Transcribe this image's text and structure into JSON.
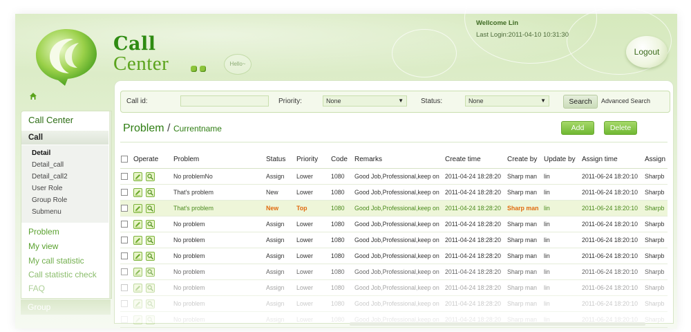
{
  "brand": {
    "line1": "Call",
    "line2": "Center",
    "hello": "Hello~"
  },
  "header": {
    "welcome": "Wellcome Lin",
    "last_login": "Last Login:2011-04-10 10:31:30",
    "logout": "Logout"
  },
  "colors": {
    "brand_green": "#2e8b12",
    "accent_green": "#6fb832",
    "highlight_orange": "#e06b10"
  },
  "sidebar": {
    "title": "Call Center",
    "section": "Call",
    "sub_items": [
      "Detail",
      "Detail_call",
      "Detail_call2",
      "User Role",
      "Group Role",
      "Submenu"
    ],
    "active_sub": "Detail",
    "links": [
      "Problem",
      "My view",
      "My call statistic",
      "Call statistic check",
      "FAQ"
    ],
    "group": "Group"
  },
  "search": {
    "callid_label": "Call id:",
    "callid_value": "",
    "priority_label": "Priority:",
    "priority_value": "None",
    "status_label": "Status:",
    "status_value": "None",
    "search_button": "Search",
    "advanced": "Advanced Search"
  },
  "page": {
    "title": "Problem",
    "slash": "/",
    "subtitle": "Currentname",
    "add": "Add",
    "delete": "Delete"
  },
  "table": {
    "columns": [
      "Operate",
      "Problem",
      "Status",
      "Priority",
      "Code",
      "Remarks",
      "Create time",
      "Create by",
      "Update by",
      "Assign time",
      "Assign"
    ],
    "rows": [
      {
        "problem": "No problemNo",
        "status": "Assign",
        "priority": "Lower",
        "code": "1080",
        "remarks": "Good Job,Professional,keep on",
        "create_time": "2011-04-24 18:28:20",
        "create_by": "Sharp man",
        "update_by": "lin",
        "assign_time": "2011-06-24 18:20:10",
        "assign": "Sharpb"
      },
      {
        "problem": "That's problem",
        "status": "New",
        "priority": "Lower",
        "code": "1080",
        "remarks": "Good Job,Professional,keep on",
        "create_time": "2011-04-24 18:28:20",
        "create_by": "Sharp man",
        "update_by": "lin",
        "assign_time": "2011-06-24 18:20:10",
        "assign": "Sharpb"
      },
      {
        "problem": "That's problem",
        "status": "New",
        "priority": "Top",
        "code": "1080",
        "remarks": "Good Job,Professional,keep on",
        "create_time": "2011-04-24 18:28:20",
        "create_by": "Sharp man",
        "update_by": "lin",
        "assign_time": "2011-06-24 18:20:10",
        "assign": "Sharpb"
      },
      {
        "problem": "No problem",
        "status": "Assign",
        "priority": "Lower",
        "code": "1080",
        "remarks": "Good Job,Professional,keep on",
        "create_time": "2011-04-24 18:28:20",
        "create_by": "Sharp man",
        "update_by": "lin",
        "assign_time": "2011-06-24 18:20:10",
        "assign": "Sharpb"
      },
      {
        "problem": "No problem",
        "status": "Assign",
        "priority": "Lower",
        "code": "1080",
        "remarks": "Good Job,Professional,keep on",
        "create_time": "2011-04-24 18:28:20",
        "create_by": "Sharp man",
        "update_by": "lin",
        "assign_time": "2011-06-24 18:20:10",
        "assign": "Sharpb"
      },
      {
        "problem": "No problem",
        "status": "Assign",
        "priority": "Lower",
        "code": "1080",
        "remarks": "Good Job,Professional,keep on",
        "create_time": "2011-04-24 18:28:20",
        "create_by": "Sharp man",
        "update_by": "lin",
        "assign_time": "2011-06-24 18:20:10",
        "assign": "Sharpb"
      },
      {
        "problem": "No problem",
        "status": "Assign",
        "priority": "Lower",
        "code": "1080",
        "remarks": "Good Job,Professional,keep on",
        "create_time": "2011-04-24 18:28:20",
        "create_by": "Sharp man",
        "update_by": "lin",
        "assign_time": "2011-06-24 18:20:10",
        "assign": "Sharpb"
      },
      {
        "problem": "No problem",
        "status": "Assign",
        "priority": "Lower",
        "code": "1080",
        "remarks": "Good Job,Professional,keep on",
        "create_time": "2011-04-24 18:28:20",
        "create_by": "Sharp man",
        "update_by": "lin",
        "assign_time": "2011-06-24 18:20:10",
        "assign": "Sharpb"
      },
      {
        "problem": "No problem",
        "status": "Assign",
        "priority": "Lower",
        "code": "1080",
        "remarks": "Good Job,Professional,keep on",
        "create_time": "2011-04-24 18:28:20",
        "create_by": "Sharp man",
        "update_by": "lin",
        "assign_time": "2011-06-24 18:20:10",
        "assign": "Sharpb"
      },
      {
        "problem": "No problem",
        "status": "Assign",
        "priority": "Lower",
        "code": "1080",
        "remarks": "Good Job,Professional,keep on",
        "create_time": "2011-04-24 18:28:20",
        "create_by": "Sharp man",
        "update_by": "lin",
        "assign_time": "2011-06-24 18:20:10",
        "assign": "Sharpb"
      }
    ],
    "highlight_row": 2
  }
}
